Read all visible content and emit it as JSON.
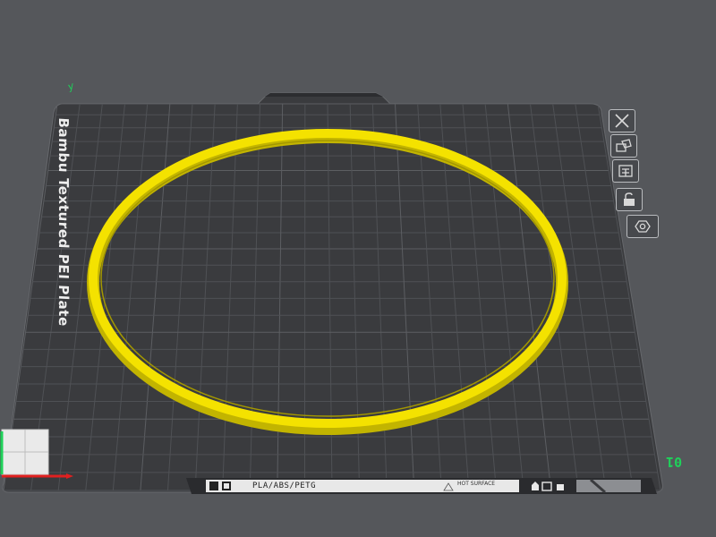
{
  "plate": {
    "name": "Bambu Textured PEI Plate",
    "number": "01",
    "materials": "PLA/ABS/PETG",
    "warning": "HOT SURFACE",
    "axis_y_label": "y"
  },
  "sidebar_tools": [
    {
      "name": "delete-plate-button",
      "icon": "close-icon"
    },
    {
      "name": "arrange-button",
      "icon": "arrange-icon"
    },
    {
      "name": "orient-button",
      "icon": "orient-icon"
    },
    {
      "name": "lock-button",
      "icon": "lock-icon"
    },
    {
      "name": "plate-settings-button",
      "icon": "gear-icon"
    }
  ],
  "colors": {
    "background": "#55575b",
    "plate": "#3a3b3e",
    "grid": "#4f5155",
    "model": "#f4e200",
    "model_shade": "#c2b400",
    "accent_green": "#1fd15a",
    "axis_red": "#e02020"
  },
  "model": {
    "shape": "ring"
  }
}
